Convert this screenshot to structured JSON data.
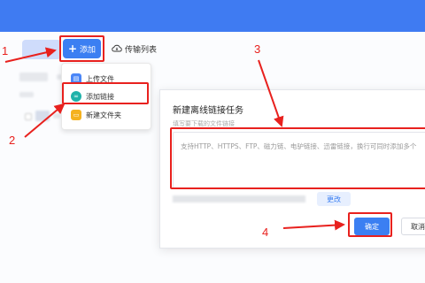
{
  "toolbar": {
    "add_label": "添加",
    "transfer_label": "传输列表"
  },
  "menu": {
    "items": [
      {
        "label": "上传文件",
        "icon": "document-icon",
        "color": "#4a86f7"
      },
      {
        "label": "添加链接",
        "icon": "link-icon",
        "color": "#20b2aa"
      },
      {
        "label": "新建文件夹",
        "icon": "folder-icon",
        "color": "#f5b21f"
      }
    ]
  },
  "dialog": {
    "title": "新建离线链接任务",
    "hint": "填写要下载的文件链接",
    "placeholder": "支持HTTP、HTTPS、FTP、磁力链、电驴链接、迅雷链接，换行可同时添加多个",
    "change_label": "更改",
    "confirm_label": "确定",
    "cancel_label": "取消"
  },
  "annotations": {
    "step1": "1",
    "step2": "2",
    "step3": "3",
    "step4": "4"
  },
  "colors": {
    "accent": "#3b7ff2",
    "highlight": "#e8211e",
    "header": "#3f7bf2"
  }
}
